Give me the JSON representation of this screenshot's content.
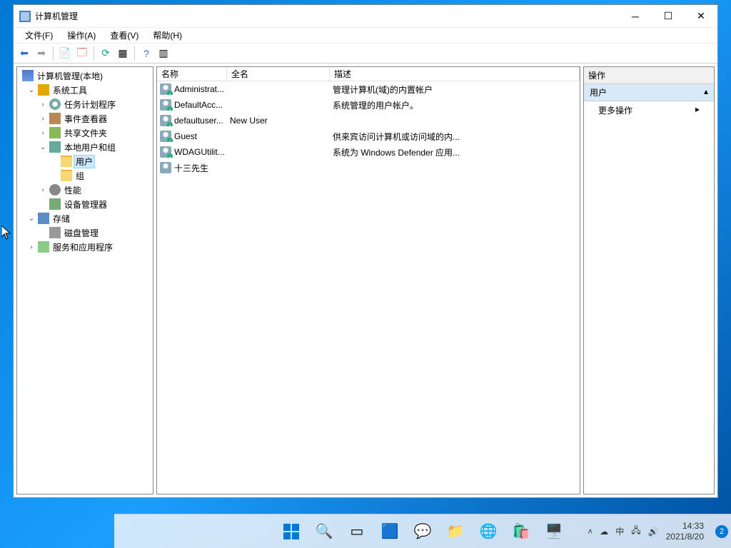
{
  "window": {
    "title": "计算机管理"
  },
  "menu": {
    "file": "文件(F)",
    "action": "操作(A)",
    "view": "查看(V)",
    "help": "帮助(H)"
  },
  "tree": {
    "root": "计算机管理(本地)",
    "system_tools": "系统工具",
    "task_scheduler": "任务计划程序",
    "event_viewer": "事件查看器",
    "shared_folders": "共享文件夹",
    "local_users_groups": "本地用户和组",
    "users": "用户",
    "groups": "组",
    "performance": "性能",
    "device_manager": "设备管理器",
    "storage": "存储",
    "disk_management": "磁盘管理",
    "services_apps": "服务和应用程序"
  },
  "list": {
    "columns": {
      "name": "名称",
      "full": "全名",
      "desc": "描述"
    },
    "rows": [
      {
        "name": "Administrat...",
        "full": "",
        "desc": "管理计算机(域)的内置帐户"
      },
      {
        "name": "DefaultAcc...",
        "full": "",
        "desc": "系统管理的用户帐户。"
      },
      {
        "name": "defaultuser...",
        "full": "New User",
        "desc": ""
      },
      {
        "name": "Guest",
        "full": "",
        "desc": "供来宾访问计算机或访问域的内..."
      },
      {
        "name": "WDAGUtilit...",
        "full": "",
        "desc": "系统为 Windows Defender 应用..."
      },
      {
        "name": "十三先生",
        "full": "",
        "desc": ""
      }
    ]
  },
  "actions": {
    "header": "操作",
    "section": "用户",
    "more": "更多操作"
  },
  "taskbar": {
    "time": "14:33",
    "date": "2021/8/20",
    "ime": "中",
    "badge": "2"
  }
}
